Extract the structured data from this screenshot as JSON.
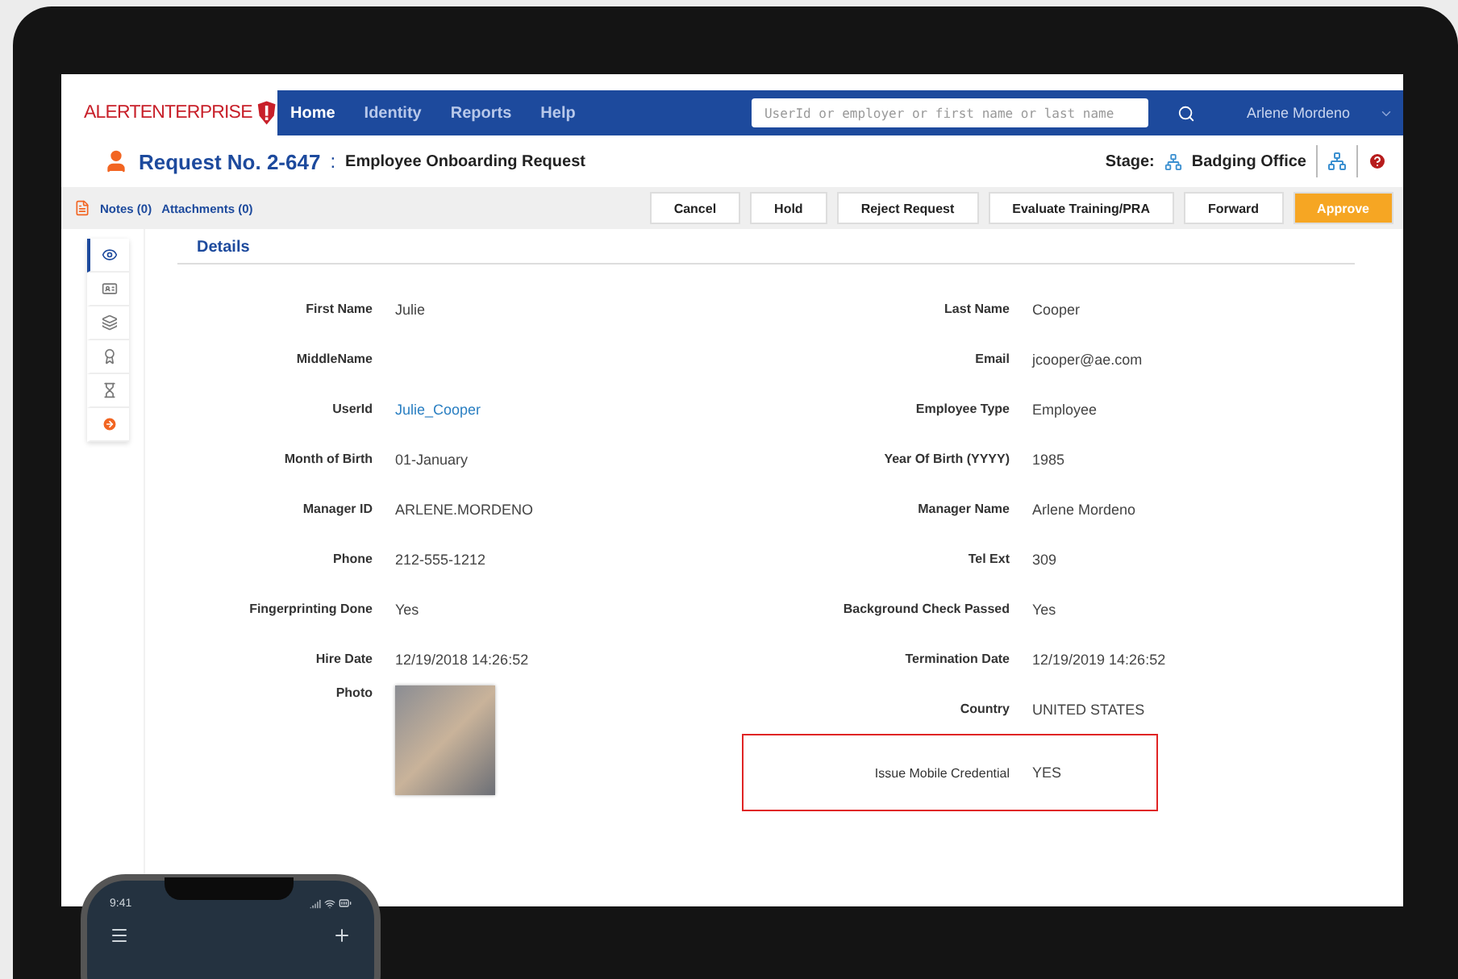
{
  "brand": {
    "first": "ALERT",
    "second": "ENTERPRISE"
  },
  "nav": {
    "items": [
      {
        "label": "Home",
        "selected": true
      },
      {
        "label": "Identity",
        "selected": false
      },
      {
        "label": "Reports",
        "selected": false
      },
      {
        "label": "Help",
        "selected": false
      }
    ],
    "search": {
      "placeholder": "UserId or employer or first name or last name"
    },
    "user": "Arlene Mordeno"
  },
  "request": {
    "number": "Request No. 2-647",
    "separator": ":",
    "type": "Employee Onboarding Request",
    "stage_label": "Stage:",
    "stage": "Badging Office"
  },
  "toolbar": {
    "links": [
      "Notes (0)",
      "Attachments (0)"
    ],
    "buttons": [
      {
        "label": "Cancel",
        "kind": "plain"
      },
      {
        "label": "Hold",
        "kind": "plain"
      },
      {
        "label": "Reject Request",
        "kind": "plain"
      },
      {
        "label": "Evaluate Training/PRA",
        "kind": "plain"
      },
      {
        "label": "Forward",
        "kind": "plain"
      },
      {
        "label": "Approve",
        "kind": "primary"
      }
    ]
  },
  "side_tabs": [
    {
      "kind": "eye",
      "selected": true
    },
    {
      "kind": "card",
      "selected": false
    },
    {
      "kind": "layers",
      "selected": false
    },
    {
      "kind": "award",
      "selected": false
    },
    {
      "kind": "hourglass",
      "selected": false
    },
    {
      "kind": "next",
      "selected": false
    }
  ],
  "section": "Details",
  "fields_left": [
    {
      "label": "First Name",
      "kind": "text",
      "value": "Julie"
    },
    {
      "label": "MiddleName",
      "kind": "text"
    },
    {
      "label": "UserId",
      "kind": "link",
      "value": "Julie_Cooper"
    },
    {
      "label": "Month of Birth",
      "kind": "text",
      "value": "01-January"
    },
    {
      "label": "Manager ID",
      "kind": "text",
      "value": "ARLENE.MORDENO"
    },
    {
      "label": "Phone",
      "kind": "text",
      "value": "212-555-1212"
    },
    {
      "label": "Fingerprinting Done",
      "kind": "text",
      "value": "Yes"
    },
    {
      "label": "Hire Date",
      "kind": "text",
      "value": "12/19/2018 14:26:52"
    },
    {
      "label": "Photo",
      "kind": "photo"
    }
  ],
  "fields_right": [
    {
      "label": "Last Name",
      "kind": "text",
      "value": "Cooper",
      "highlighted": false
    },
    {
      "label": "Email",
      "kind": "text",
      "value": "jcooper@ae.com",
      "highlighted": false
    },
    {
      "label": "Employee Type",
      "kind": "text",
      "value": "Employee",
      "highlighted": false
    },
    {
      "label": "Year Of Birth (YYYY)",
      "kind": "text",
      "value": "1985",
      "highlighted": false
    },
    {
      "label": "Manager Name",
      "kind": "text",
      "value": "Arlene Mordeno",
      "highlighted": false
    },
    {
      "label": "Tel Ext",
      "kind": "text",
      "value": "309",
      "highlighted": false
    },
    {
      "label": "Background Check Passed",
      "kind": "text",
      "value": "Yes",
      "highlighted": false
    },
    {
      "label": "Termination Date",
      "kind": "text",
      "value": "12/19/2019 14:26:52",
      "highlighted": false
    },
    {
      "label": "Country",
      "kind": "text",
      "value": "UNITED STATES",
      "highlighted": false
    },
    {
      "label": "Issue Mobile Credential",
      "kind": "text",
      "value": "YES",
      "highlighted": true
    }
  ],
  "phone": {
    "time": "9:41"
  }
}
